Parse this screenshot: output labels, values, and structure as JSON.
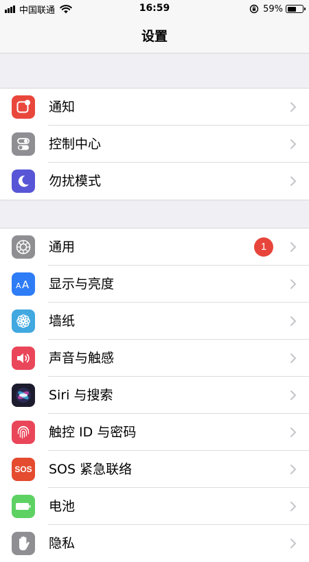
{
  "status_bar": {
    "carrier": "中国联通",
    "time": "16:59",
    "battery_percent": "59%",
    "battery_level": 0.59,
    "signal_bars": 4
  },
  "nav": {
    "title": "设置"
  },
  "group1": [
    {
      "label": "通知",
      "icon": "notifications-icon",
      "color": "#e9473c"
    },
    {
      "label": "控制中心",
      "icon": "control-center-icon",
      "color": "#8e8e93"
    },
    {
      "label": "勿扰模式",
      "icon": "moon-icon",
      "color": "#5856d6"
    }
  ],
  "group2": [
    {
      "label": "通用",
      "icon": "gear-icon",
      "color": "#8e8e93",
      "badge": "1"
    },
    {
      "label": "显示与亮度",
      "icon": "display-icon",
      "color": "#2e7cf6"
    },
    {
      "label": "墙纸",
      "icon": "wallpaper-flower-icon",
      "color": "#41a8e0"
    },
    {
      "label": "声音与触感",
      "icon": "speaker-icon",
      "color": "#ea4659"
    },
    {
      "label": "Siri 与搜索",
      "icon": "siri-icon",
      "color": "#1c1c2e"
    },
    {
      "label": "触控 ID 与密码",
      "icon": "fingerprint-icon",
      "color": "#ea4659"
    },
    {
      "label": "SOS 紧急联络",
      "icon": "sos-icon",
      "color": "#e44b2f",
      "icon_text": "SOS"
    },
    {
      "label": "电池",
      "icon": "battery-icon",
      "color": "#5dd263"
    },
    {
      "label": "隐私",
      "icon": "hand-icon",
      "color": "#8e8e93"
    }
  ]
}
